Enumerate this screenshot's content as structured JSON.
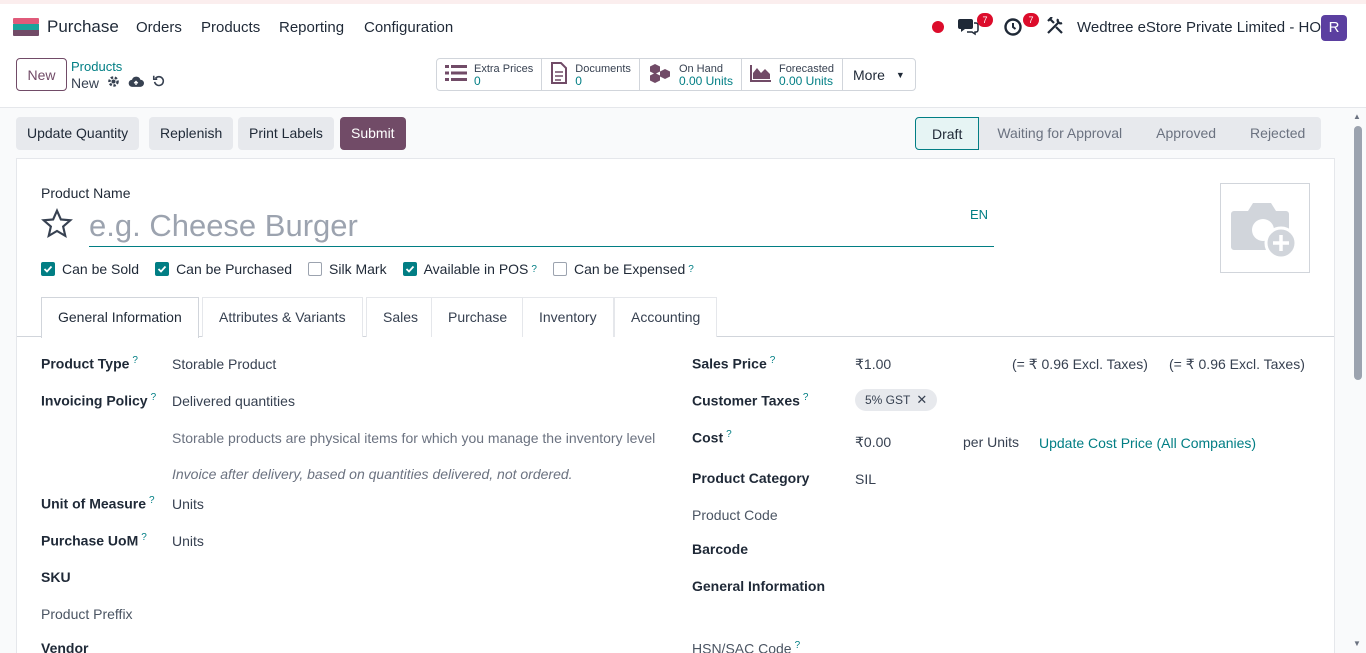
{
  "nav": {
    "app_name": "Purchase",
    "menus": [
      "Orders",
      "Products",
      "Reporting",
      "Configuration"
    ],
    "messages_count": "7",
    "activities_count": "7",
    "company": "Wedtree eStore Private Limited - HO",
    "avatar_letter": "R"
  },
  "control": {
    "new_label": "New",
    "breadcrumb_parent": "Products",
    "breadcrumb_current": "New",
    "smart_buttons": [
      {
        "label": "Extra Prices",
        "value": "0"
      },
      {
        "label": "Documents",
        "value": "0"
      },
      {
        "label": "On Hand",
        "value": "0.00 Units"
      },
      {
        "label": "Forecasted",
        "value": "0.00 Units"
      }
    ],
    "more_label": "More"
  },
  "actions": {
    "update_quantity": "Update Quantity",
    "replenish": "Replenish",
    "print_labels": "Print Labels",
    "submit": "Submit"
  },
  "statusbar": [
    "Draft",
    "Waiting for Approval",
    "Approved",
    "Rejected"
  ],
  "form": {
    "product_name_label": "Product Name",
    "product_name_placeholder": "e.g. Cheese Burger",
    "lang": "EN",
    "checkboxes": [
      {
        "label": "Can be Sold",
        "checked": true
      },
      {
        "label": "Can be Purchased",
        "checked": true
      },
      {
        "label": "Silk Mark",
        "checked": false
      },
      {
        "label": "Available in POS",
        "checked": true
      },
      {
        "label": "Can be Expensed",
        "checked": false
      }
    ],
    "tabs": [
      "General Information",
      "Attributes & Variants",
      "Sales",
      "Purchase",
      "Inventory",
      "Accounting"
    ],
    "left": {
      "product_type_label": "Product Type",
      "product_type_value": "Storable Product",
      "invoicing_policy_label": "Invoicing Policy",
      "invoicing_policy_value": "Delivered quantities",
      "help_storable": "Storable products are physical items for which you manage the inventory level",
      "help_invoice": "Invoice after delivery, based on quantities delivered, not ordered.",
      "uom_label": "Unit of Measure",
      "uom_value": "Units",
      "purchase_uom_label": "Purchase UoM",
      "purchase_uom_value": "Units",
      "sku_label": "SKU",
      "prefix_label": "Product Preffix",
      "vendor_label": "Vendor"
    },
    "right": {
      "sales_price_label": "Sales Price",
      "sales_price_value": "₹1.00",
      "excl_taxes_1": "(= ₹ 0.96 Excl. Taxes)",
      "excl_taxes_2": "(= ₹ 0.96 Excl. Taxes)",
      "customer_taxes_label": "Customer Taxes",
      "tax_tag": "5% GST",
      "cost_label": "Cost",
      "cost_value": "₹0.00",
      "per_units": "per Units",
      "update_cost_link": "Update Cost Price (All Companies)",
      "category_label": "Product Category",
      "category_value": "SIL",
      "product_code_label": "Product Code",
      "barcode_label": "Barcode",
      "general_info_label": "General Information",
      "hsn_label": "HSN/SAC Code"
    }
  }
}
